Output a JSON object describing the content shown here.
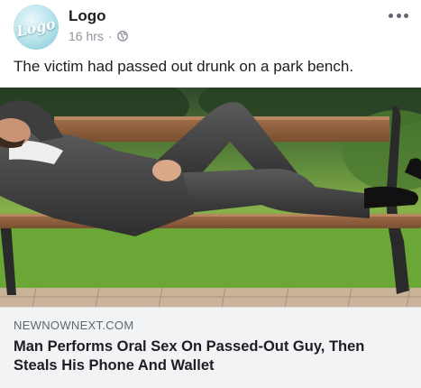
{
  "page": {
    "name": "Logo",
    "avatar_text": "Logo",
    "time": "16 hrs",
    "separator": "·"
  },
  "post": {
    "caption": "The victim had passed out drunk on a park bench."
  },
  "link": {
    "domain": "NEWNOWNEXT.COM",
    "headline": "Man Performs Oral Sex On Passed-Out Guy, Then Steals His Phone And Wallet"
  },
  "icons": {
    "privacy": "globe-icon",
    "menu": "more-options-icon"
  },
  "colors": {
    "text": "#1c1e21",
    "meta": "#8d949e",
    "link_bg": "#f2f3f5"
  }
}
